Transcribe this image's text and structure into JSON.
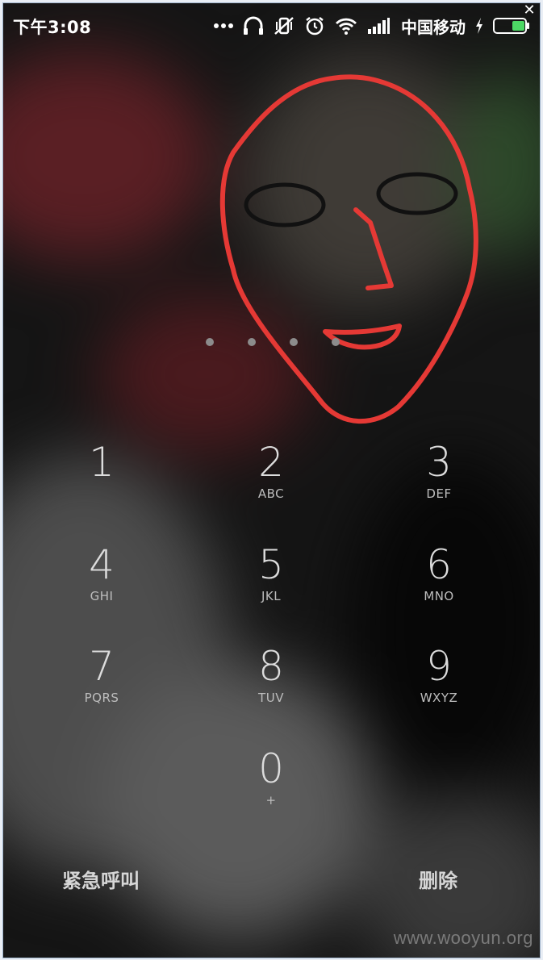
{
  "status_bar": {
    "time": "下午3:08",
    "icons": [
      "more-dots-icon",
      "headset-icon",
      "vibrate-off-icon",
      "alarm-icon",
      "wifi-icon",
      "signal-icon",
      "charging-icon",
      "battery-icon"
    ],
    "carrier": "中国移动"
  },
  "window": {
    "close_glyph": "✕"
  },
  "pin": {
    "dots_count": 4
  },
  "keypad": {
    "keys": [
      {
        "digit": "1",
        "letters": ""
      },
      {
        "digit": "2",
        "letters": "ABC"
      },
      {
        "digit": "3",
        "letters": "DEF"
      },
      {
        "digit": "4",
        "letters": "GHI"
      },
      {
        "digit": "5",
        "letters": "JKL"
      },
      {
        "digit": "6",
        "letters": "MNO"
      },
      {
        "digit": "7",
        "letters": "PQRS"
      },
      {
        "digit": "8",
        "letters": "TUV"
      },
      {
        "digit": "9",
        "letters": "WXYZ"
      },
      {
        "digit": "0",
        "letters": "+"
      }
    ]
  },
  "actions": {
    "emergency_call": "紧急呼叫",
    "delete": "删除"
  },
  "watermark": "www.wooyun.org",
  "colors": {
    "face_outline": "#e53935",
    "eyes": "#111111",
    "battery_fill": "#4cd964"
  }
}
